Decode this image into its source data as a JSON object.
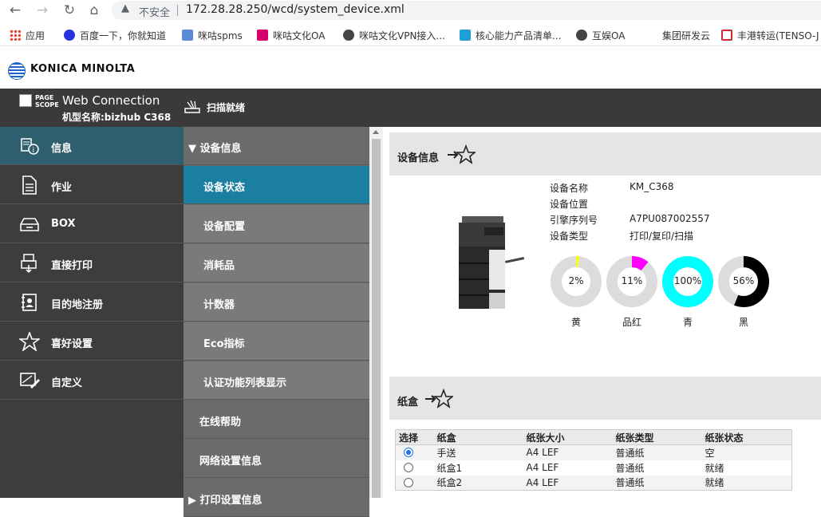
{
  "browser": {
    "security_label": "不安全",
    "url": "172.28.28.250/wcd/system_device.xml",
    "bookmarks": [
      {
        "label": "应用",
        "color": "#4285f4"
      },
      {
        "label": "百度一下，你就知道",
        "color": "#2932e1"
      },
      {
        "label": "咪咕spms",
        "color": "#5b8bd8"
      },
      {
        "label": "咪咕文化OA",
        "color": "#d6006f"
      },
      {
        "label": "咪咕文化VPN接入...",
        "color": "#444444"
      },
      {
        "label": "核心能力产品清单...",
        "color": "#1fa0d8"
      },
      {
        "label": "互娱OA",
        "color": "#444444"
      },
      {
        "label": "集团研发云",
        "color": "#ffffff"
      },
      {
        "label": "丰港转运(TENSO-J",
        "color": "#d12b2b"
      }
    ]
  },
  "header": {
    "brand": "KONICA MINOLTA",
    "pagescope": "PAGE SCOPE",
    "app_title": "Web Connection",
    "model": "机型名称:bizhub C368",
    "scan_label": "扫描就绪"
  },
  "leftnav": [
    {
      "label": "信息",
      "icon": "info-icon",
      "active": true
    },
    {
      "label": "作业",
      "icon": "job-document-icon",
      "active": false
    },
    {
      "label": "BOX",
      "icon": "box-tray-icon",
      "active": false
    },
    {
      "label": "直接打印",
      "icon": "direct-print-icon",
      "active": false
    },
    {
      "label": "目的地注册",
      "icon": "address-book-icon",
      "active": false
    },
    {
      "label": "喜好设置",
      "icon": "star-icon",
      "active": false
    },
    {
      "label": "自定义",
      "icon": "customize-icon",
      "active": false
    }
  ],
  "subnav": [
    {
      "label": "▼ 设备信息",
      "type": "group"
    },
    {
      "label": "设备状态",
      "type": "active"
    },
    {
      "label": "设备配置",
      "type": "child"
    },
    {
      "label": "消耗品",
      "type": "child"
    },
    {
      "label": "计数器",
      "type": "child"
    },
    {
      "label": "Eco指标",
      "type": "child"
    },
    {
      "label": "认证功能列表显示",
      "type": "child"
    },
    {
      "label": "在线帮助",
      "type": "group"
    },
    {
      "label": "网络设置信息",
      "type": "group"
    },
    {
      "label": "▶ 打印设置信息",
      "type": "group"
    }
  ],
  "device_section": {
    "title": "设备信息",
    "fields": [
      {
        "label": "设备名称",
        "value": "KM_C368"
      },
      {
        "label": "设备位置",
        "value": ""
      },
      {
        "label": "引擎序列号",
        "value": "A7PU087002557"
      },
      {
        "label": "设备类型",
        "value": "打印/复印/扫描"
      }
    ],
    "toners": [
      {
        "label": "黄",
        "percent": 2,
        "percent_text": "2%",
        "color": "#ffff00"
      },
      {
        "label": "品红",
        "percent": 11,
        "percent_text": "11%",
        "color": "#ff00ff"
      },
      {
        "label": "青",
        "percent": 100,
        "percent_text": "100%",
        "color": "#00ffff"
      },
      {
        "label": "黑",
        "percent": 56,
        "percent_text": "56%",
        "color": "#000000"
      }
    ]
  },
  "tray_section": {
    "title": "纸盒",
    "columns": [
      "选择",
      "纸盒",
      "纸张大小",
      "纸张类型",
      "纸张状态"
    ],
    "rows": [
      {
        "selected": true,
        "tray": "手送",
        "size": "A4 LEF",
        "type": "普通纸",
        "status": "空"
      },
      {
        "selected": false,
        "tray": "纸盒1",
        "size": "A4 LEF",
        "type": "普通纸",
        "status": "就绪"
      },
      {
        "selected": false,
        "tray": "纸盒2",
        "size": "A4 LEF",
        "type": "普通纸",
        "status": "就绪"
      }
    ]
  }
}
